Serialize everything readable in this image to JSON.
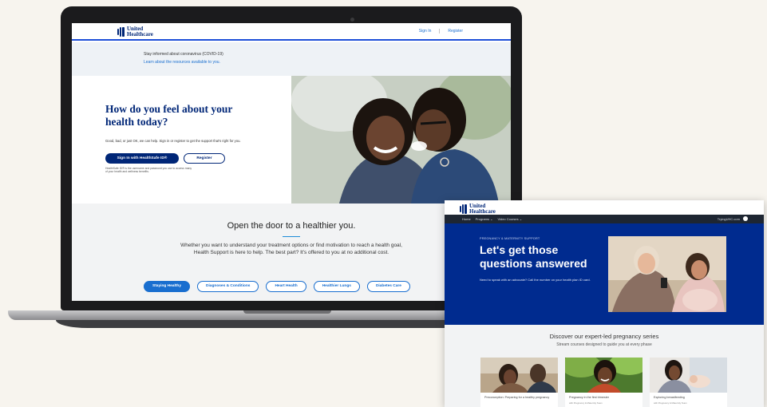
{
  "laptop_page": {
    "header": {
      "logo_line1": "United",
      "logo_line2": "Healthcare",
      "sign_in": "Sign In",
      "register": "Register"
    },
    "covid": {
      "title": "Stay informed about coronavirus (COVID-19)",
      "link": "Learn about the resources available to you."
    },
    "hero": {
      "title": "How do you feel about your health today?",
      "subtitle": "Good, bad, or just OK, we can help. Sign in or register to get the support that's right for you.",
      "primary_button": "Sign In with HealthSafe ID®",
      "secondary_button": "Register",
      "note": "HealthSafe ID® is the username and password you use to access many of your health and wellness benefits."
    },
    "open_door": {
      "title": "Open the door to a healthier you.",
      "body": "Whether you want to understand your treatment options or find motivation to reach a health goal, Health Support is here to help. The best part? It's offered to you at no additional cost.",
      "chips": [
        "Staying Healthy",
        "Diagnoses & Conditions",
        "Heart Health",
        "Healthier Lungs",
        "Diabetes Care"
      ]
    }
  },
  "window_page": {
    "header": {
      "logo_line1": "United",
      "logo_line2": "Healthcare"
    },
    "nav": {
      "items": [
        "Home",
        "Programs ⌄",
        "Video Courses ⌄"
      ],
      "right_text": "TryingUHC.com"
    },
    "hero": {
      "eyebrow": "PREGNANCY & MATERNITY SUPPORT",
      "title": "Let's get those questions answered",
      "subtitle": "Need to speak with an advocate? Call the number on your health plan ID card."
    },
    "series": {
      "title": "Discover our expert-led pregnancy series",
      "subtitle": "Stream courses designed to guide you at every phase",
      "cards": [
        {
          "title": "Preconception: Preparing for a healthy pregnancy",
          "meta": ""
        },
        {
          "title": "Pregnancy in the first trimester",
          "meta": "with Pregnancy & Maternity Team"
        },
        {
          "title": "Exploring breastfeeding",
          "meta": "with Pregnancy & Maternity Team"
        }
      ]
    }
  },
  "colors": {
    "brand_navy": "#002677",
    "link_blue": "#196ecf",
    "hero_blue": "#002b8f",
    "background": "#f7f4ee"
  }
}
